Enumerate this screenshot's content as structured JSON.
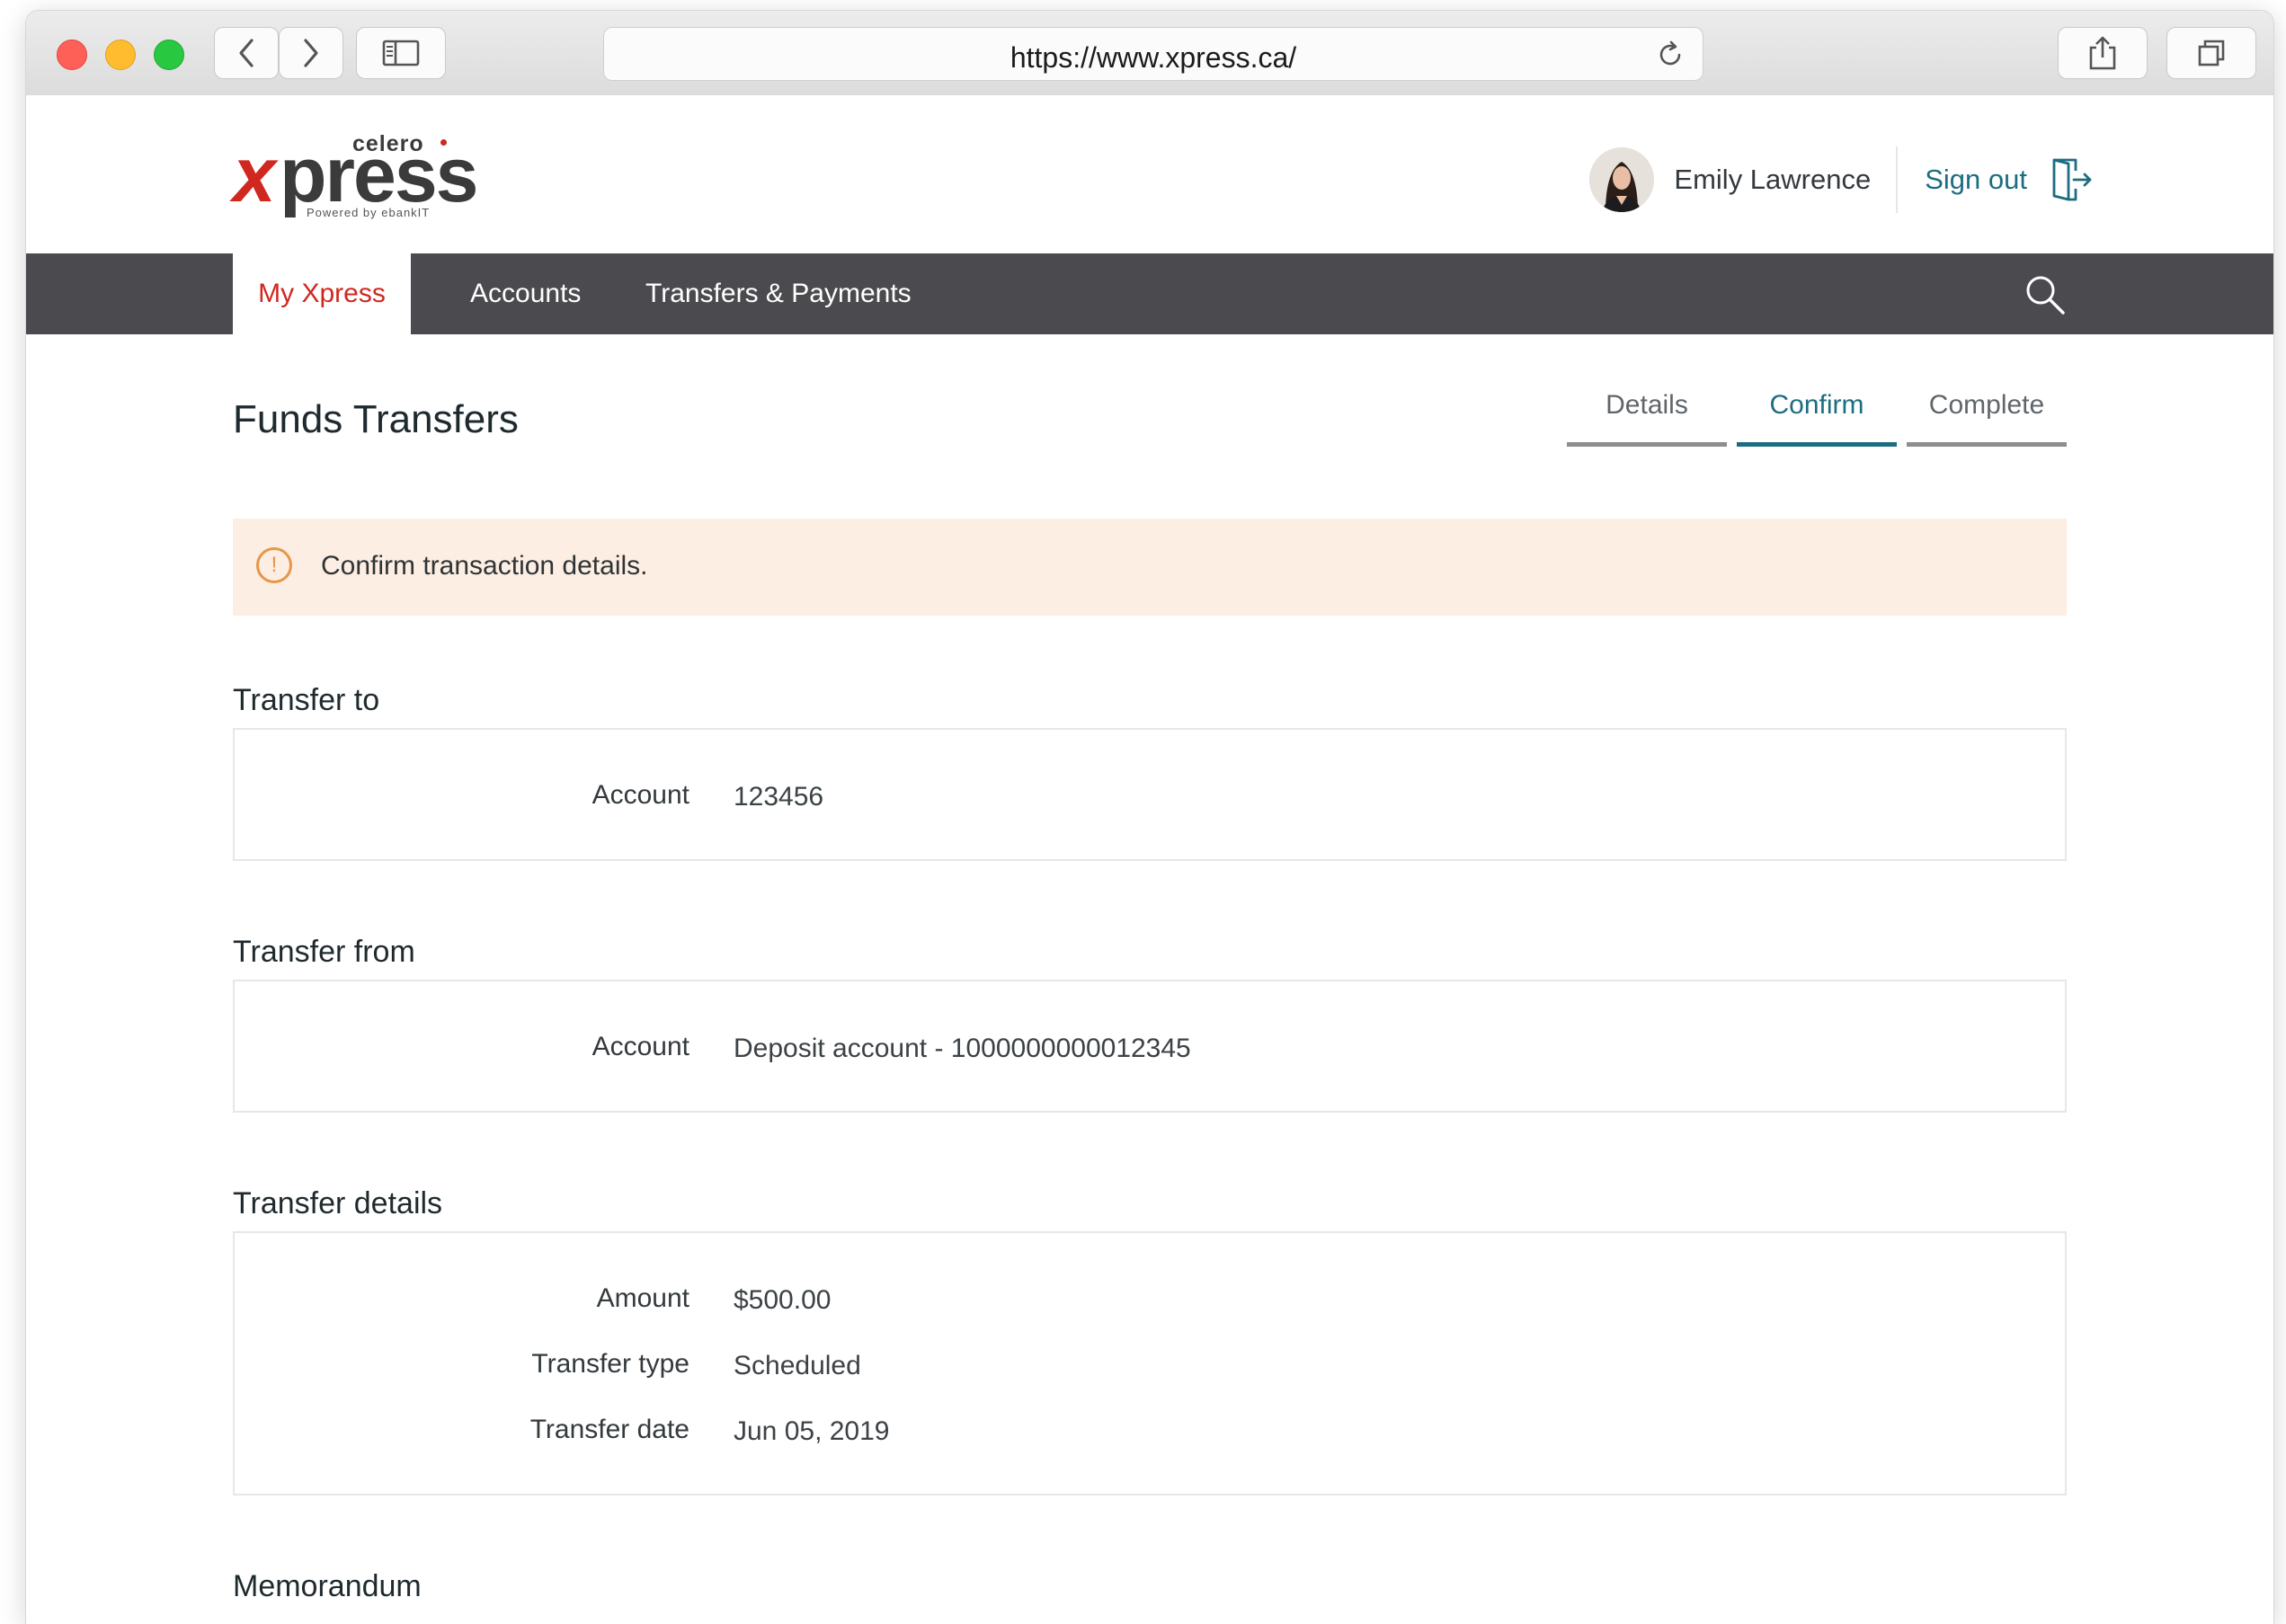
{
  "browser": {
    "url": "https://www.xpress.ca/"
  },
  "brand": {
    "celero": "celero",
    "x": "x",
    "press": "press",
    "powered_by": "Powered by ebankIT"
  },
  "user": {
    "name": "Emily Lawrence",
    "sign_out_label": "Sign out"
  },
  "nav": {
    "items": [
      {
        "label": "My Xpress"
      },
      {
        "label": "Accounts"
      },
      {
        "label": "Transfers & Payments"
      }
    ]
  },
  "page": {
    "title": "Funds Transfers",
    "steps": [
      {
        "label": "Details"
      },
      {
        "label": "Confirm"
      },
      {
        "label": "Complete"
      }
    ],
    "active_step": "Confirm",
    "alert_text": "Confirm transaction details."
  },
  "transfer_to": {
    "title": "Transfer to",
    "rows": [
      {
        "label": "Account",
        "value": "123456"
      }
    ]
  },
  "transfer_from": {
    "title": "Transfer from",
    "rows": [
      {
        "label": "Account",
        "value": "Deposit account - 1000000000012345"
      }
    ]
  },
  "transfer_details": {
    "title": "Transfer details",
    "rows": [
      {
        "label": "Amount",
        "value": "$500.00"
      },
      {
        "label": "Transfer type",
        "value": "Scheduled"
      },
      {
        "label": "Transfer date",
        "value": "Jun 05, 2019"
      }
    ]
  },
  "memorandum": {
    "title": "Memorandum"
  },
  "colors": {
    "brand_red": "#d0281f",
    "accent_teal": "#1d6d80",
    "nav_bg": "#4b4b4f",
    "alert_bg": "#fdeee3",
    "alert_icon": "#e8964a"
  }
}
